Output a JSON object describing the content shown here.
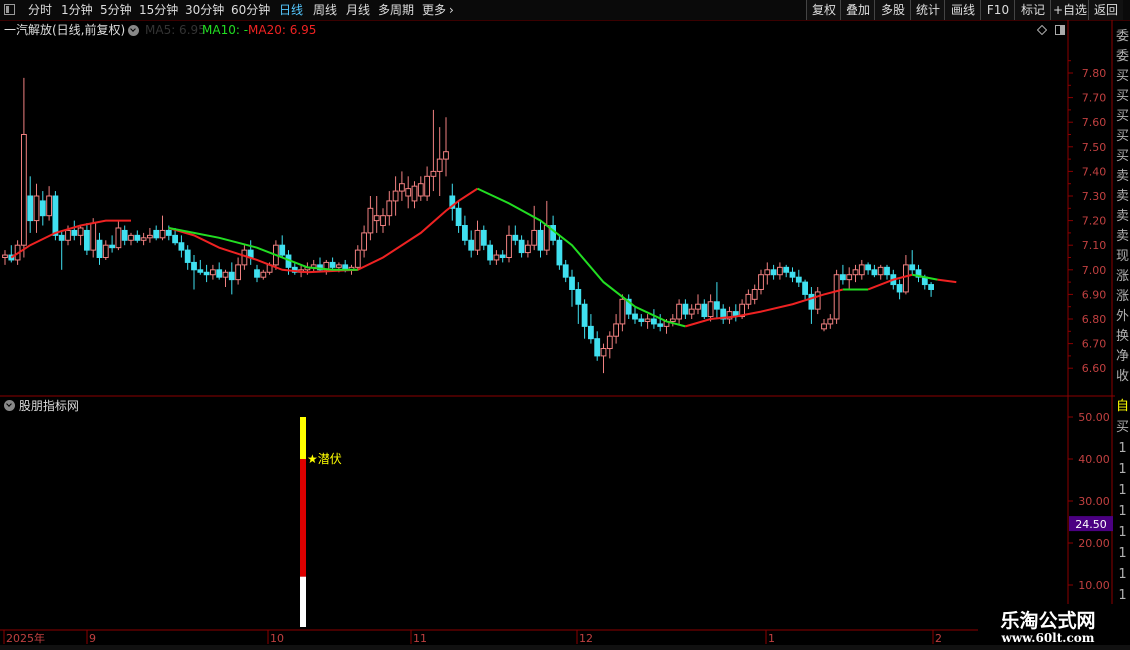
{
  "toolbar": {
    "periods": [
      {
        "label": "分时",
        "active": false
      },
      {
        "label": "1分钟",
        "active": false
      },
      {
        "label": "5分钟",
        "active": false
      },
      {
        "label": "15分钟",
        "active": false
      },
      {
        "label": "30分钟",
        "active": false
      },
      {
        "label": "60分钟",
        "active": false
      },
      {
        "label": "日线",
        "active": true
      },
      {
        "label": "周线",
        "active": false
      },
      {
        "label": "月线",
        "active": false
      },
      {
        "label": "多周期",
        "active": false
      },
      {
        "label": "更多",
        "active": false
      }
    ],
    "more_arrow": "›",
    "right_buttons": [
      "复权",
      "叠加",
      "多股",
      "统计",
      "画线",
      "F10",
      "标记",
      "+自选",
      "返回"
    ]
  },
  "main_chart": {
    "title": "一汽解放(日线,前复权)",
    "ma_labels": [
      {
        "text": "MA5: 6.95",
        "color": "#333333"
      },
      {
        "text": "MA10: -",
        "color": "#22dd22"
      },
      {
        "text": "MA20: 6.95",
        "color": "#ee2222"
      }
    ],
    "price_ticks": [
      "7.80",
      "7.70",
      "7.60",
      "7.50",
      "7.40",
      "7.30",
      "7.20",
      "7.10",
      "7.00",
      "6.90",
      "6.80",
      "6.70",
      "6.60"
    ]
  },
  "sub_chart": {
    "title": "股朋指标网",
    "signal_label": "★潜伏",
    "value_ticks": [
      "50.00",
      "40.00",
      "30.00",
      "20.00",
      "10.00"
    ],
    "current_value": "24.50"
  },
  "date_axis": [
    "2025年",
    "9",
    "10",
    "11",
    "12",
    "1",
    "2"
  ],
  "right_strip_chars": [
    "委",
    "委",
    "买",
    "买",
    "买",
    "买",
    "买",
    "卖",
    "卖",
    "卖",
    "卖",
    "现",
    "涨",
    "涨",
    "外",
    "换",
    "净",
    "收"
  ],
  "right_strip_sub_chars": [
    "自",
    "买",
    "1",
    "1",
    "1",
    "1",
    "1",
    "1",
    "1",
    "1"
  ],
  "watermark": {
    "line1": "乐淘公式网",
    "line2": "www.60lt.com"
  },
  "colors": {
    "up": "#f08080",
    "down": "#40e0f0",
    "ma10": "#22dd22",
    "ma20": "#ee2222",
    "accent": "#55c8ff",
    "value_badge": "#4b0082"
  },
  "chart_data": {
    "type": "candlestick",
    "ylim": [
      6.55,
      7.85
    ],
    "up_color": "#f08080",
    "down_color": "#40e0f0",
    "candles": [
      [
        7.05,
        7.08,
        7.02,
        7.06
      ],
      [
        7.06,
        7.1,
        7.03,
        7.04
      ],
      [
        7.04,
        7.12,
        7.02,
        7.1
      ],
      [
        7.1,
        7.78,
        7.05,
        7.55
      ],
      [
        7.3,
        7.38,
        7.15,
        7.2
      ],
      [
        7.2,
        7.35,
        7.15,
        7.3
      ],
      [
        7.28,
        7.32,
        7.18,
        7.22
      ],
      [
        7.22,
        7.34,
        7.2,
        7.3
      ],
      [
        7.3,
        7.32,
        7.12,
        7.14
      ],
      [
        7.14,
        7.16,
        7.0,
        7.12
      ],
      [
        7.12,
        7.18,
        7.1,
        7.16
      ],
      [
        7.16,
        7.2,
        7.12,
        7.14
      ],
      [
        7.14,
        7.18,
        7.1,
        7.17
      ],
      [
        7.16,
        7.19,
        7.06,
        7.08
      ],
      [
        7.08,
        7.21,
        7.05,
        7.19
      ],
      [
        7.12,
        7.15,
        7.02,
        7.05
      ],
      [
        7.05,
        7.12,
        7.04,
        7.1
      ],
      [
        7.1,
        7.14,
        7.07,
        7.09
      ],
      [
        7.09,
        7.2,
        7.08,
        7.17
      ],
      [
        7.16,
        7.18,
        7.1,
        7.12
      ],
      [
        7.12,
        7.15,
        7.1,
        7.14
      ],
      [
        7.14,
        7.16,
        7.11,
        7.12
      ],
      [
        7.12,
        7.15,
        7.1,
        7.13
      ],
      [
        7.13,
        7.17,
        7.11,
        7.14
      ],
      [
        7.16,
        7.18,
        7.12,
        7.13
      ],
      [
        7.13,
        7.22,
        7.12,
        7.16
      ],
      [
        7.16,
        7.18,
        7.12,
        7.14
      ],
      [
        7.14,
        7.17,
        7.1,
        7.11
      ],
      [
        7.11,
        7.14,
        7.05,
        7.08
      ],
      [
        7.08,
        7.1,
        7.0,
        7.03
      ],
      [
        7.03,
        7.06,
        6.92,
        7.0
      ],
      [
        7.0,
        7.04,
        6.98,
        6.99
      ],
      [
        6.99,
        7.02,
        6.95,
        6.98
      ],
      [
        6.98,
        7.02,
        6.96,
        7.0
      ],
      [
        7.0,
        7.03,
        6.96,
        6.97
      ],
      [
        6.97,
        7.0,
        6.93,
        6.99
      ],
      [
        6.99,
        7.03,
        6.9,
        6.96
      ],
      [
        6.96,
        7.05,
        6.94,
        7.02
      ],
      [
        7.02,
        7.1,
        7.0,
        7.08
      ],
      [
        7.08,
        7.12,
        7.02,
        7.05
      ],
      [
        7.0,
        7.02,
        6.95,
        6.97
      ],
      [
        6.97,
        7.0,
        6.96,
        6.99
      ],
      [
        6.99,
        7.03,
        6.98,
        7.02
      ],
      [
        7.02,
        7.12,
        7.0,
        7.1
      ],
      [
        7.1,
        7.14,
        7.05,
        7.06
      ],
      [
        7.06,
        7.08,
        6.98,
        7.01
      ],
      [
        7.01,
        7.03,
        6.98,
        6.99
      ],
      [
        6.99,
        7.02,
        6.97,
        7.0
      ],
      [
        7.0,
        7.03,
        6.98,
        7.01
      ],
      [
        7.01,
        7.04,
        6.99,
        7.02
      ],
      [
        7.02,
        7.05,
        6.99,
        7.0
      ],
      [
        7.0,
        7.04,
        6.98,
        7.03
      ],
      [
        7.03,
        7.05,
        7.0,
        7.01
      ],
      [
        7.01,
        7.03,
        6.99,
        7.02
      ],
      [
        7.02,
        7.04,
        6.99,
        7.0
      ],
      [
        7.0,
        7.02,
        6.98,
        7.01
      ],
      [
        7.01,
        7.1,
        7.0,
        7.08
      ],
      [
        7.08,
        7.18,
        7.05,
        7.15
      ],
      [
        7.15,
        7.3,
        7.12,
        7.25
      ],
      [
        7.2,
        7.3,
        7.15,
        7.22
      ],
      [
        7.18,
        7.25,
        7.15,
        7.22
      ],
      [
        7.22,
        7.32,
        7.18,
        7.28
      ],
      [
        7.28,
        7.38,
        7.22,
        7.32
      ],
      [
        7.32,
        7.4,
        7.28,
        7.35
      ],
      [
        7.3,
        7.38,
        7.25,
        7.33
      ],
      [
        7.28,
        7.36,
        7.25,
        7.34
      ],
      [
        7.3,
        7.38,
        7.28,
        7.35
      ],
      [
        7.3,
        7.42,
        7.28,
        7.38
      ],
      [
        7.38,
        7.65,
        7.32,
        7.4
      ],
      [
        7.4,
        7.58,
        7.3,
        7.45
      ],
      [
        7.45,
        7.62,
        7.38,
        7.48
      ],
      [
        7.3,
        7.35,
        7.2,
        7.25
      ],
      [
        7.25,
        7.28,
        7.15,
        7.18
      ],
      [
        7.18,
        7.22,
        7.1,
        7.12
      ],
      [
        7.12,
        7.16,
        7.05,
        7.08
      ],
      [
        7.08,
        7.2,
        7.06,
        7.16
      ],
      [
        7.16,
        7.18,
        7.08,
        7.1
      ],
      [
        7.1,
        7.12,
        7.02,
        7.04
      ],
      [
        7.04,
        7.08,
        7.02,
        7.06
      ],
      [
        7.06,
        7.08,
        7.03,
        7.05
      ],
      [
        7.05,
        7.18,
        7.03,
        7.14
      ],
      [
        7.14,
        7.18,
        7.1,
        7.12
      ],
      [
        7.12,
        7.14,
        7.05,
        7.07
      ],
      [
        7.07,
        7.12,
        7.05,
        7.1
      ],
      [
        7.1,
        7.26,
        7.08,
        7.16
      ],
      [
        7.16,
        7.2,
        7.05,
        7.08
      ],
      [
        7.08,
        7.28,
        7.06,
        7.18
      ],
      [
        7.18,
        7.22,
        7.1,
        7.12
      ],
      [
        7.12,
        7.14,
        7.0,
        7.02
      ],
      [
        7.02,
        7.04,
        6.95,
        6.97
      ],
      [
        6.97,
        7.0,
        6.85,
        6.92
      ],
      [
        6.92,
        6.95,
        6.78,
        6.86
      ],
      [
        6.86,
        6.88,
        6.72,
        6.77
      ],
      [
        6.77,
        6.82,
        6.7,
        6.72
      ],
      [
        6.72,
        6.75,
        6.63,
        6.65
      ],
      [
        6.65,
        6.7,
        6.58,
        6.68
      ],
      [
        6.68,
        6.75,
        6.64,
        6.73
      ],
      [
        6.73,
        6.82,
        6.7,
        6.78
      ],
      [
        6.78,
        6.9,
        6.75,
        6.88
      ],
      [
        6.88,
        6.9,
        6.8,
        6.82
      ],
      [
        6.82,
        6.85,
        6.78,
        6.8
      ],
      [
        6.8,
        6.82,
        6.77,
        6.79
      ],
      [
        6.79,
        6.82,
        6.76,
        6.8
      ],
      [
        6.8,
        6.84,
        6.76,
        6.78
      ],
      [
        6.78,
        6.82,
        6.75,
        6.77
      ],
      [
        6.77,
        6.8,
        6.74,
        6.79
      ],
      [
        6.79,
        6.82,
        6.77,
        6.8
      ],
      [
        6.8,
        6.88,
        6.78,
        6.86
      ],
      [
        6.86,
        6.88,
        6.8,
        6.82
      ],
      [
        6.82,
        6.86,
        6.8,
        6.84
      ],
      [
        6.84,
        6.9,
        6.82,
        6.86
      ],
      [
        6.86,
        6.88,
        6.8,
        6.81
      ],
      [
        6.81,
        6.9,
        6.79,
        6.87
      ],
      [
        6.87,
        6.95,
        6.8,
        6.84
      ],
      [
        6.84,
        6.86,
        6.78,
        6.8
      ],
      [
        6.8,
        6.85,
        6.78,
        6.83
      ],
      [
        6.83,
        6.86,
        6.79,
        6.81
      ],
      [
        6.81,
        6.88,
        6.8,
        6.86
      ],
      [
        6.86,
        6.92,
        6.84,
        6.9
      ],
      [
        6.88,
        6.94,
        6.86,
        6.92
      ],
      [
        6.92,
        7.0,
        6.9,
        6.98
      ],
      [
        6.98,
        7.03,
        6.94,
        7.0
      ],
      [
        7.0,
        7.02,
        6.96,
        6.98
      ],
      [
        6.98,
        7.03,
        6.96,
        7.01
      ],
      [
        7.01,
        7.02,
        6.97,
        6.99
      ],
      [
        6.99,
        7.01,
        6.95,
        6.97
      ],
      [
        6.97,
        7.0,
        6.93,
        6.95
      ],
      [
        6.95,
        6.96,
        6.88,
        6.9
      ],
      [
        6.9,
        6.93,
        6.78,
        6.84
      ],
      [
        6.84,
        6.93,
        6.82,
        6.91
      ],
      [
        6.76,
        6.8,
        6.75,
        6.78
      ],
      [
        6.78,
        6.82,
        6.76,
        6.8
      ],
      [
        6.8,
        7.0,
        6.78,
        6.98
      ],
      [
        6.98,
        7.02,
        6.94,
        6.96
      ],
      [
        6.96,
        7.01,
        6.92,
        6.98
      ],
      [
        6.98,
        7.02,
        6.95,
        7.0
      ],
      [
        6.98,
        7.04,
        6.96,
        7.02
      ],
      [
        7.02,
        7.03,
        6.98,
        7.0
      ],
      [
        7.0,
        7.02,
        6.97,
        6.98
      ],
      [
        6.98,
        7.02,
        6.96,
        7.01
      ],
      [
        7.01,
        7.02,
        6.96,
        6.98
      ],
      [
        6.98,
        7.0,
        6.92,
        6.94
      ],
      [
        6.94,
        6.96,
        6.88,
        6.91
      ],
      [
        6.91,
        7.06,
        6.9,
        7.02
      ],
      [
        7.02,
        7.08,
        6.98,
        7.0
      ],
      [
        7.0,
        7.02,
        6.95,
        6.97
      ],
      [
        6.97,
        6.98,
        6.92,
        6.94
      ],
      [
        6.94,
        6.95,
        6.89,
        6.92
      ]
    ],
    "ma20": [
      [
        1,
        7.05
      ],
      [
        4,
        7.1
      ],
      [
        8,
        7.15
      ],
      [
        12,
        7.18
      ],
      [
        16,
        7.2
      ],
      [
        20,
        7.2
      ],
      null,
      [
        26,
        7.17
      ],
      [
        30,
        7.14
      ],
      [
        34,
        7.09
      ],
      [
        40,
        7.04
      ],
      [
        44,
        7.0
      ],
      [
        48,
        6.99
      ],
      [
        56,
        7.0
      ],
      [
        60,
        7.05
      ],
      [
        66,
        7.15
      ],
      [
        70,
        7.24
      ],
      [
        72,
        7.28
      ],
      [
        75,
        7.33
      ]
    ],
    "ma10": [
      [
        26,
        7.17
      ],
      [
        30,
        7.15
      ],
      [
        34,
        7.13
      ],
      [
        40,
        7.09
      ],
      [
        44,
        7.05
      ],
      [
        48,
        7.01
      ],
      [
        52,
        7.0
      ],
      [
        56,
        7.0
      ],
      null,
      [
        75,
        7.33
      ],
      [
        80,
        7.27
      ],
      [
        85,
        7.2
      ],
      [
        90,
        7.1
      ],
      [
        95,
        6.95
      ],
      [
        100,
        6.85
      ],
      [
        105,
        6.79
      ],
      [
        108,
        6.77
      ]
    ],
    "ma20b": [
      [
        108,
        6.77
      ],
      [
        112,
        6.8
      ],
      [
        116,
        6.81
      ],
      [
        120,
        6.83
      ],
      [
        125,
        6.86
      ],
      [
        130,
        6.9
      ],
      [
        133,
        6.92
      ],
      null,
      [
        137,
        6.92
      ],
      [
        141,
        6.96
      ],
      [
        144,
        6.98
      ],
      null,
      [
        148,
        6.96
      ],
      [
        151,
        6.95
      ]
    ],
    "ma10b": [
      [
        133,
        6.92
      ],
      [
        137,
        6.92
      ],
      null,
      [
        144,
        6.98
      ],
      [
        148,
        6.96
      ]
    ],
    "sub": {
      "x": 10,
      "bar_segments": [
        [
          0,
          12,
          "#ffffff"
        ],
        [
          12,
          40,
          "#dd0000"
        ],
        [
          40,
          50,
          "#ffff00"
        ]
      ],
      "ylim": [
        0,
        50
      ]
    }
  }
}
